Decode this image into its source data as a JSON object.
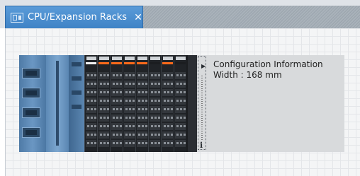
{
  "tab": {
    "title": "CPU/Expansion Racks",
    "close_glyph": "✕",
    "icon": "rack-icon"
  },
  "rack": {
    "units": [
      {
        "type": "power-supply"
      },
      {
        "type": "cpu-unit"
      },
      {
        "type": "cpu-unit-ext"
      },
      {
        "type": "io-unit",
        "top_color": "#f2f2f2"
      },
      {
        "type": "io-unit",
        "top_color": "#ff6a1a"
      },
      {
        "type": "io-unit",
        "top_color": "#ff6a1a"
      },
      {
        "type": "io-unit",
        "top_color": "#ff6a1a"
      },
      {
        "type": "io-unit",
        "top_color": "#ff6a1a"
      },
      {
        "type": "io-unit",
        "top_color": "#1b1d20"
      },
      {
        "type": "io-unit",
        "top_color": "#ff6a1a"
      },
      {
        "type": "io-unit",
        "top_color": "#1b1d20"
      },
      {
        "type": "end-cover"
      }
    ]
  },
  "info_panel": {
    "title": "Configuration Information",
    "width_text": "Width : 168 mm",
    "expand_icon": "expand-arrow-icon",
    "info_glyph": "i"
  },
  "colors": {
    "tab_active": "#4a8fd0",
    "tab_text": "#ffffff",
    "io_indicator": "#ff6a1a"
  }
}
